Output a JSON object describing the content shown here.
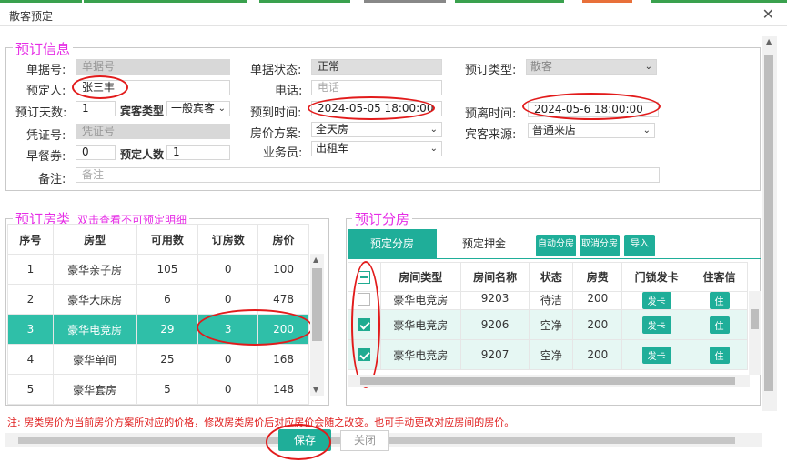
{
  "window": {
    "title": "散客预定"
  },
  "colors": {
    "accent": "#2fbfa8",
    "legend": "#e62ce6",
    "annot": "#e21b1b"
  },
  "booking": {
    "legend": "预订信息",
    "order_no_label": "单据号:",
    "order_no_placeholder": "单据号",
    "status_label": "单据状态:",
    "status_value": "正常",
    "type_label": "预订类型:",
    "type_value": "散客",
    "booker_label": "预定人:",
    "booker_value": "张三丰",
    "phone_label": "电话:",
    "phone_placeholder": "电话",
    "days_label": "预订天数:",
    "days_value": "1",
    "guest_type_label": "宾客类型",
    "guest_type_value": "一般宾客",
    "arrive_label": "预到时间:",
    "arrive_value": "2024-05-05 18:00:00",
    "leave_label": "预离时间:",
    "leave_value": "2024-05-6 18:00:00",
    "voucher_label": "凭证号:",
    "voucher_placeholder": "凭证号",
    "price_plan_label": "房价方案:",
    "price_plan_value": "全天房",
    "source_label": "宾客来源:",
    "source_value": "普通来店",
    "breakfast_label": "早餐券:",
    "breakfast_value": "0",
    "persons_label": "预定人数",
    "persons_value": "1",
    "salesman_label": "业务员:",
    "salesman_value": "出租车",
    "remark_label": "备注:",
    "remark_placeholder": "备注"
  },
  "room_types": {
    "legend": "预订房类",
    "hint": "双击查看不可预定明细",
    "columns": [
      "序号",
      "房型",
      "可用数",
      "订房数",
      "房价"
    ],
    "rows": [
      [
        "1",
        "豪华亲子房",
        "105",
        "0",
        "100"
      ],
      [
        "2",
        "豪华大床房",
        "6",
        "0",
        "478"
      ],
      [
        "3",
        "豪华电竞房",
        "29",
        "3",
        "200"
      ],
      [
        "4",
        "豪华单间",
        "25",
        "0",
        "168"
      ],
      [
        "5",
        "豪华套房",
        "5",
        "0",
        "148"
      ]
    ]
  },
  "room_assign": {
    "legend": "预订分房",
    "tab_assign": "预定分房",
    "tab_deposit": "预定押金",
    "btn_auto": "自动分房",
    "btn_cancel": "取消分房",
    "btn_import": "导入",
    "columns": [
      "",
      "房间类型",
      "房间名称",
      "状态",
      "房费",
      "门锁发卡",
      "住客信"
    ],
    "card_label": "发卡",
    "rows": [
      [
        "豪华电竞房",
        "9203",
        "待洁",
        "200"
      ],
      [
        "豪华电竞房",
        "9206",
        "空净",
        "200"
      ],
      [
        "豪华电竞房",
        "9207",
        "空净",
        "200"
      ]
    ]
  },
  "note": "注: 房类房价为当前房价方案所对应的价格，修改房类房价后对应房价会随之改变。也可手动更改对应房间的房价。",
  "footer": {
    "save": "保存",
    "close": "关闭"
  }
}
